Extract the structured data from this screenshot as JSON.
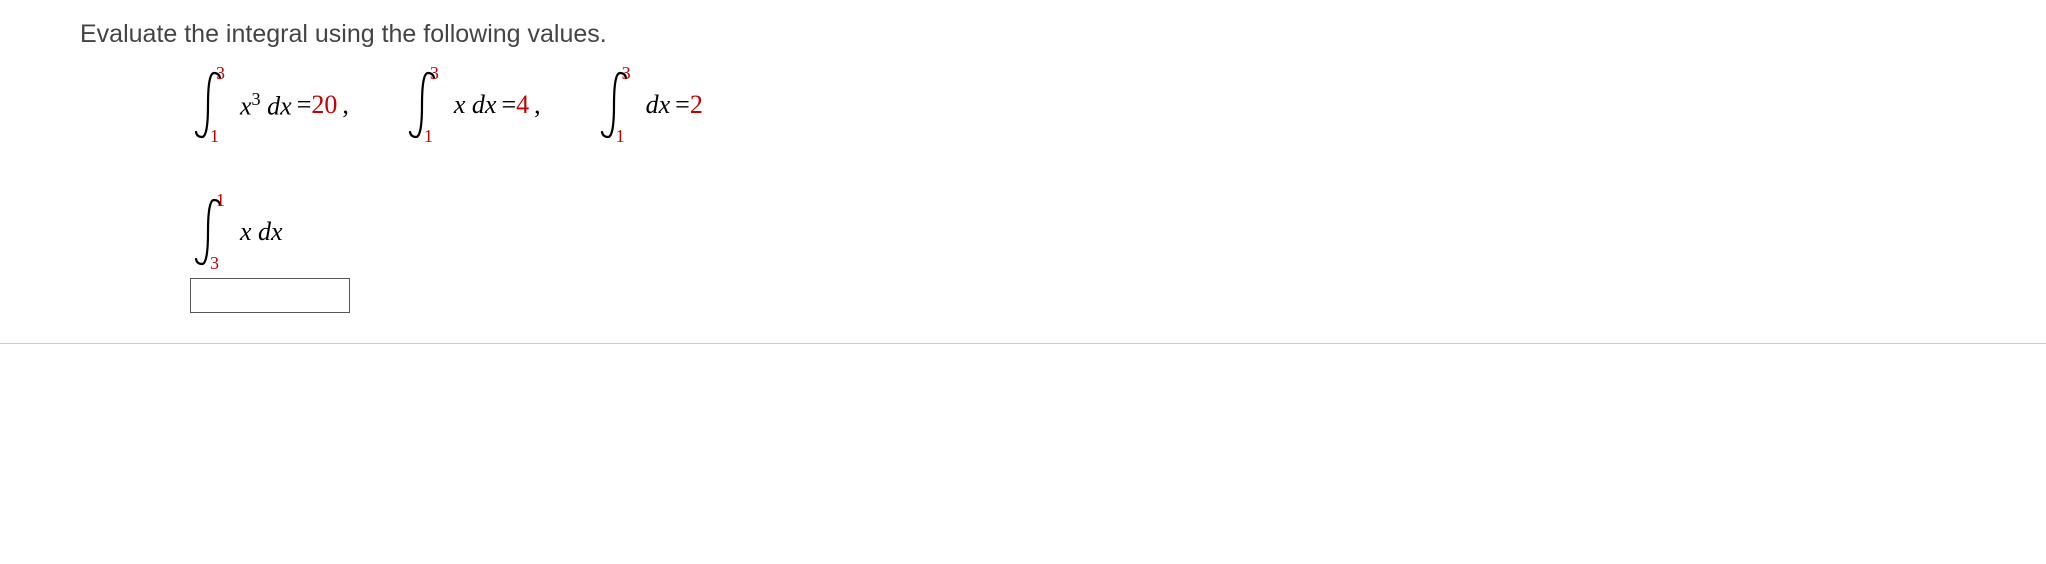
{
  "question": "Evaluate the integral using the following values.",
  "equations": [
    {
      "lower": "1",
      "upper": "3",
      "integrand_pre": "x",
      "integrand_sup": "3",
      "integrand_post": " dx",
      "equals": " = ",
      "value": "20",
      "trailing": ","
    },
    {
      "lower": "1",
      "upper": "3",
      "integrand_pre": "x dx",
      "integrand_sup": "",
      "integrand_post": "",
      "equals": " = ",
      "value": "4",
      "trailing": ","
    },
    {
      "lower": "1",
      "upper": "3",
      "integrand_pre": "dx",
      "integrand_sup": "",
      "integrand_post": "",
      "equals": " = ",
      "value": "2",
      "trailing": ""
    }
  ],
  "target": {
    "lower": "3",
    "upper": "1",
    "integrand": "x dx"
  }
}
